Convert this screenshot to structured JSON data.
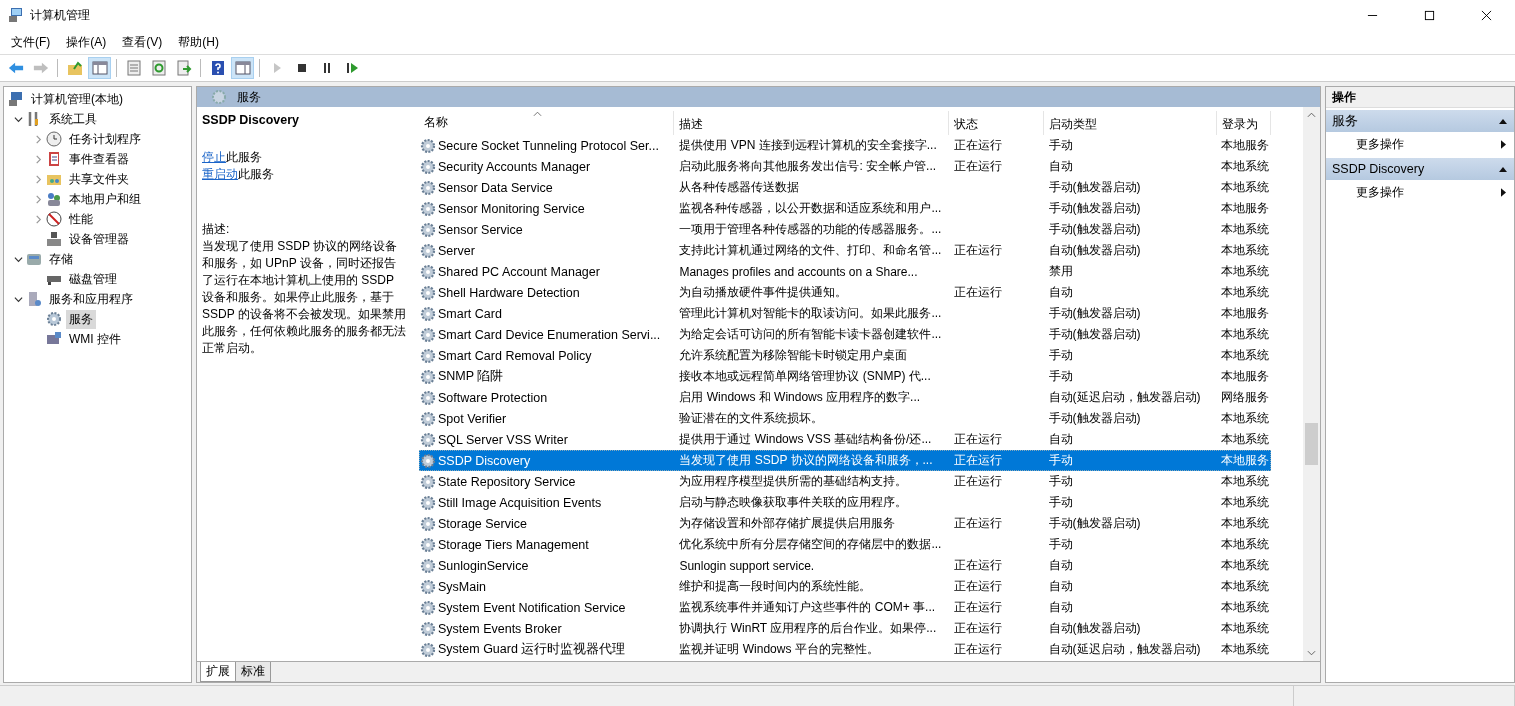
{
  "window": {
    "title": "计算机管理"
  },
  "menu": [
    {
      "label": "文件(F)"
    },
    {
      "label": "操作(A)"
    },
    {
      "label": "查看(V)"
    },
    {
      "label": "帮助(H)"
    }
  ],
  "toolbar": [
    {
      "kind": "back",
      "disabled": false,
      "on": false
    },
    {
      "kind": "forward",
      "disabled": true,
      "on": false
    },
    {
      "kind": "sep"
    },
    {
      "kind": "up",
      "disabled": false,
      "on": false
    },
    {
      "kind": "tree",
      "disabled": false,
      "on": true
    },
    {
      "kind": "sep"
    },
    {
      "kind": "properties",
      "disabled": false,
      "on": false
    },
    {
      "kind": "refresh",
      "disabled": false,
      "on": false
    },
    {
      "kind": "export",
      "disabled": false,
      "on": false
    },
    {
      "kind": "sep"
    },
    {
      "kind": "help",
      "disabled": false,
      "on": false
    },
    {
      "kind": "actionpane",
      "disabled": false,
      "on": true
    },
    {
      "kind": "sep"
    },
    {
      "kind": "play",
      "disabled": true,
      "on": false
    },
    {
      "kind": "stop",
      "disabled": false,
      "on": false
    },
    {
      "kind": "pause",
      "disabled": false,
      "on": false
    },
    {
      "kind": "resume",
      "disabled": false,
      "on": false
    }
  ],
  "tree": {
    "label": "计算机管理(本地)",
    "kind": "computer",
    "selected": false,
    "children": [
      {
        "label": "系统工具",
        "kind": "tools",
        "expanded": true,
        "selected": false,
        "children": [
          {
            "label": "任务计划程序",
            "kind": "clock",
            "expanded": false,
            "selected": false
          },
          {
            "label": "事件查看器",
            "kind": "log",
            "expanded": false,
            "selected": false
          },
          {
            "label": "共享文件夹",
            "kind": "folder",
            "expanded": false,
            "selected": false
          },
          {
            "label": "本地用户和组",
            "kind": "users",
            "expanded": false,
            "selected": false
          },
          {
            "label": "性能",
            "kind": "perf",
            "expanded": false,
            "selected": false
          },
          {
            "label": "设备管理器",
            "kind": "device",
            "selected": false
          }
        ]
      },
      {
        "label": "存储",
        "kind": "storage",
        "expanded": true,
        "selected": false,
        "children": [
          {
            "label": "磁盘管理",
            "kind": "disk",
            "selected": false
          }
        ]
      },
      {
        "label": "服务和应用程序",
        "kind": "apps",
        "expanded": true,
        "selected": false,
        "children": [
          {
            "label": "服务",
            "kind": "gear",
            "selected": true
          },
          {
            "label": "WMI 控件",
            "kind": "wmi",
            "selected": false
          }
        ]
      }
    ]
  },
  "center": {
    "title": "服务"
  },
  "details": {
    "title": "SSDP Discovery",
    "actions": [
      {
        "link": "停止",
        "rest": "此服务"
      },
      {
        "link": "重启动",
        "rest": "此服务"
      }
    ],
    "description_label": "描述:",
    "description": "当发现了使用 SSDP 协议的网络设备和服务，如 UPnP 设备，同时还报告了运行在本地计算机上使用的 SSDP 设备和服务。如果停止此服务，基于 SSDP 的设备将不会被发现。如果禁用此服务，任何依赖此服务的服务都无法正常启动。"
  },
  "table": {
    "columns": [
      {
        "label": "名称",
        "sorted": true
      },
      {
        "label": "描述",
        "sorted": false
      },
      {
        "label": "状态",
        "sorted": false
      },
      {
        "label": "启动类型",
        "sorted": false
      },
      {
        "label": "登录为",
        "sorted": false
      }
    ],
    "rows": [
      {
        "name": "Secure Socket Tunneling Protocol Ser...",
        "description": "提供使用 VPN 连接到远程计算机的安全套接字...",
        "status": "正在运行",
        "startup": "手动",
        "logon": "本地服务",
        "selected": false
      },
      {
        "name": "Security Accounts Manager",
        "description": "启动此服务将向其他服务发出信号: 安全帐户管...",
        "status": "正在运行",
        "startup": "自动",
        "logon": "本地系统",
        "selected": false
      },
      {
        "name": "Sensor Data Service",
        "description": "从各种传感器传送数据",
        "status": "",
        "startup": "手动(触发器启动)",
        "logon": "本地系统",
        "selected": false
      },
      {
        "name": "Sensor Monitoring Service",
        "description": "监视各种传感器，以公开数据和适应系统和用户...",
        "status": "",
        "startup": "手动(触发器启动)",
        "logon": "本地服务",
        "selected": false
      },
      {
        "name": "Sensor Service",
        "description": "一项用于管理各种传感器的功能的传感器服务。...",
        "status": "",
        "startup": "手动(触发器启动)",
        "logon": "本地系统",
        "selected": false
      },
      {
        "name": "Server",
        "description": "支持此计算机通过网络的文件、打印、和命名管...",
        "status": "正在运行",
        "startup": "自动(触发器启动)",
        "logon": "本地系统",
        "selected": false
      },
      {
        "name": "Shared PC Account Manager",
        "description": "Manages profiles and accounts on a Share...",
        "status": "",
        "startup": "禁用",
        "logon": "本地系统",
        "selected": false
      },
      {
        "name": "Shell Hardware Detection",
        "description": "为自动播放硬件事件提供通知。",
        "status": "正在运行",
        "startup": "自动",
        "logon": "本地系统",
        "selected": false
      },
      {
        "name": "Smart Card",
        "description": "管理此计算机对智能卡的取读访问。如果此服务...",
        "status": "",
        "startup": "手动(触发器启动)",
        "logon": "本地服务",
        "selected": false
      },
      {
        "name": "Smart Card Device Enumeration Servi...",
        "description": "为给定会话可访问的所有智能卡读卡器创建软件...",
        "status": "",
        "startup": "手动(触发器启动)",
        "logon": "本地系统",
        "selected": false
      },
      {
        "name": "Smart Card Removal Policy",
        "description": "允许系统配置为移除智能卡时锁定用户桌面",
        "status": "",
        "startup": "手动",
        "logon": "本地系统",
        "selected": false
      },
      {
        "name": "SNMP 陷阱",
        "description": "接收本地或远程简单网络管理协议 (SNMP) 代...",
        "status": "",
        "startup": "手动",
        "logon": "本地服务",
        "selected": false
      },
      {
        "name": "Software Protection",
        "description": "启用 Windows 和 Windows 应用程序的数字...",
        "status": "",
        "startup": "自动(延迟启动，触发器启动)",
        "logon": "网络服务",
        "selected": false
      },
      {
        "name": "Spot Verifier",
        "description": "验证潜在的文件系统损坏。",
        "status": "",
        "startup": "手动(触发器启动)",
        "logon": "本地系统",
        "selected": false
      },
      {
        "name": "SQL Server VSS Writer",
        "description": "提供用于通过 Windows VSS 基础结构备份/还...",
        "status": "正在运行",
        "startup": "自动",
        "logon": "本地系统",
        "selected": false
      },
      {
        "name": "SSDP Discovery",
        "description": "当发现了使用 SSDP 协议的网络设备和服务，...",
        "status": "正在运行",
        "startup": "手动",
        "logon": "本地服务",
        "selected": true
      },
      {
        "name": "State Repository Service",
        "description": "为应用程序模型提供所需的基础结构支持。",
        "status": "正在运行",
        "startup": "手动",
        "logon": "本地系统",
        "selected": false
      },
      {
        "name": "Still Image Acquisition Events",
        "description": "启动与静态映像获取事件关联的应用程序。",
        "status": "",
        "startup": "手动",
        "logon": "本地系统",
        "selected": false
      },
      {
        "name": "Storage Service",
        "description": "为存储设置和外部存储扩展提供启用服务",
        "status": "正在运行",
        "startup": "手动(触发器启动)",
        "logon": "本地系统",
        "selected": false
      },
      {
        "name": "Storage Tiers Management",
        "description": "优化系统中所有分层存储空间的存储层中的数据...",
        "status": "",
        "startup": "手动",
        "logon": "本地系统",
        "selected": false
      },
      {
        "name": "SunloginService",
        "description": "Sunlogin support service.",
        "status": "正在运行",
        "startup": "自动",
        "logon": "本地系统",
        "selected": false
      },
      {
        "name": "SysMain",
        "description": "维护和提高一段时间内的系统性能。",
        "status": "正在运行",
        "startup": "自动",
        "logon": "本地系统",
        "selected": false
      },
      {
        "name": "System Event Notification Service",
        "description": "监视系统事件并通知订户这些事件的 COM+ 事...",
        "status": "正在运行",
        "startup": "自动",
        "logon": "本地系统",
        "selected": false
      },
      {
        "name": "System Events Broker",
        "description": "协调执行 WinRT 应用程序的后台作业。如果停...",
        "status": "正在运行",
        "startup": "自动(触发器启动)",
        "logon": "本地系统",
        "selected": false
      },
      {
        "name": "System Guard 运行时监视器代理",
        "description": "监视并证明 Windows 平台的完整性。",
        "status": "正在运行",
        "startup": "自动(延迟启动，触发器启动)",
        "logon": "本地系统",
        "selected": false
      }
    ]
  },
  "bottom_tabs": [
    {
      "label": "扩展",
      "selected": true
    },
    {
      "label": "标准",
      "selected": false
    }
  ],
  "actions_pane": {
    "title": "操作",
    "sections": [
      {
        "title": "服务",
        "expanded": true,
        "items": [
          "更多操作"
        ]
      },
      {
        "title": "SSDP Discovery",
        "expanded": true,
        "items": [
          "更多操作"
        ]
      }
    ]
  }
}
